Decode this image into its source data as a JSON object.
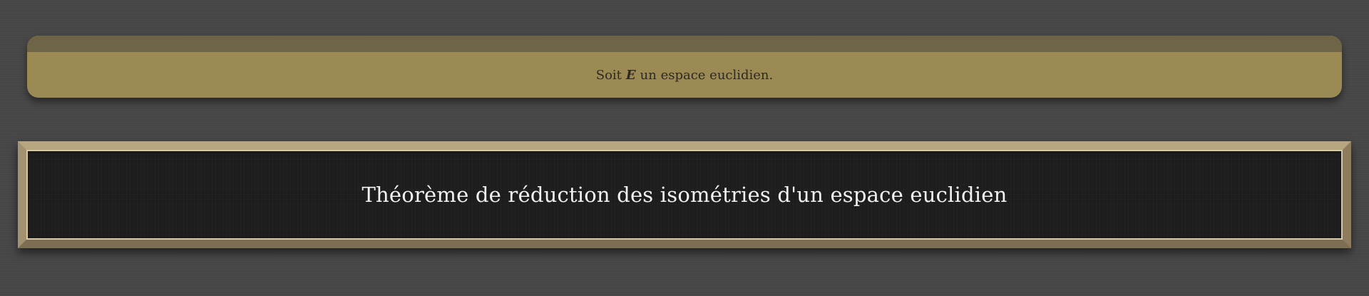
{
  "hypothesis": {
    "prefix": "Soit",
    "variable": "E",
    "suffix": "un espace euclidien."
  },
  "title_board": {
    "title": "Théorème de réduction des isométries d'un espace euclidien"
  },
  "colors": {
    "background": "#474747",
    "card_header": "#6e6446",
    "card_body": "#9b8a53",
    "board_surface": "#1d1d1d",
    "board_frame": "#a99876",
    "board_text": "#f2f2f2"
  }
}
